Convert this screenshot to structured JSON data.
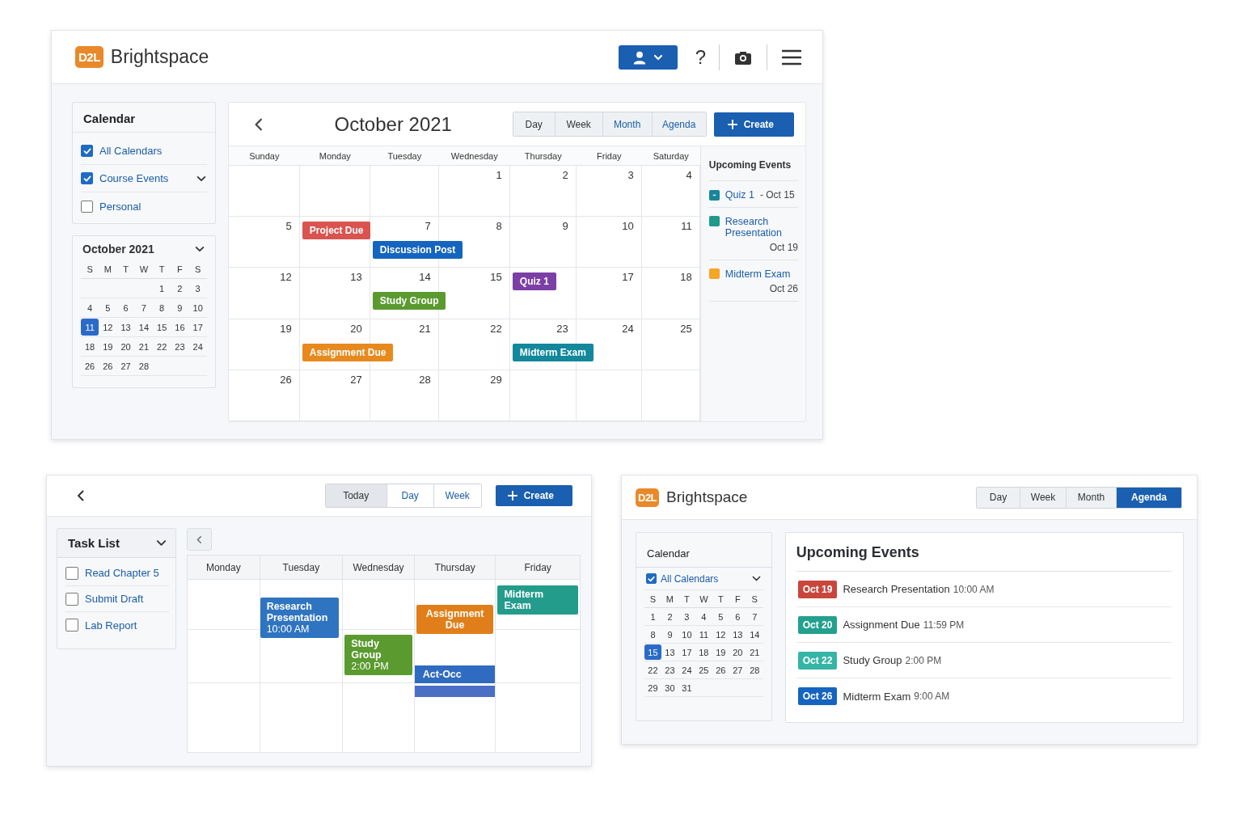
{
  "month_view": {
    "header": {
      "logo": "D2L",
      "brand": "Brightspace",
      "help": "?"
    },
    "filters": {
      "title": "Calendar",
      "items": [
        {
          "label": "All Calendars",
          "checked": true,
          "expandable": false
        },
        {
          "label": "Course Events",
          "checked": true,
          "expandable": true
        },
        {
          "label": "Personal",
          "checked": false,
          "expandable": false
        }
      ]
    },
    "mini_calendar": {
      "title": "October 2021",
      "weekdays": [
        "S",
        "M",
        "T",
        "W",
        "T",
        "F",
        "S"
      ],
      "weeks": [
        {
          "kind": "leading",
          "days": [
            {
              "day": "1",
              "selected": false
            },
            {
              "day": "2",
              "selected": false
            },
            {
              "day": "3",
              "selected": false
            }
          ]
        },
        {
          "days": [
            {
              "day": "4",
              "selected": false
            },
            {
              "day": "5",
              "selected": false
            },
            {
              "day": "6",
              "selected": false
            },
            {
              "day": "7",
              "selected": false
            },
            {
              "day": "8",
              "selected": false
            },
            {
              "day": "9",
              "selected": false
            },
            {
              "day": "10",
              "selected": false
            }
          ]
        },
        {
          "days": [
            {
              "day": "11",
              "selected": true
            },
            {
              "day": "12",
              "selected": false
            },
            {
              "day": "13",
              "selected": false
            },
            {
              "day": "14",
              "selected": false
            },
            {
              "day": "15",
              "selected": false
            },
            {
              "day": "16",
              "selected": false
            },
            {
              "day": "17",
              "selected": false
            }
          ]
        },
        {
          "days": [
            {
              "day": "18",
              "selected": false
            },
            {
              "day": "19",
              "selected": false
            },
            {
              "day": "20",
              "selected": false
            },
            {
              "day": "21",
              "selected": false
            },
            {
              "day": "22",
              "selected": false
            },
            {
              "day": "23",
              "selected": false
            },
            {
              "day": "24",
              "selected": false
            }
          ]
        },
        {
          "days": [
            {
              "day": "26",
              "selected": false
            },
            {
              "day": "26",
              "selected": false
            },
            {
              "day": "27",
              "selected": false
            },
            {
              "day": "28",
              "selected": false
            }
          ]
        }
      ]
    },
    "toolbar": {
      "title": "October 2021",
      "tabs": [
        {
          "label": "Day",
          "selected": false
        },
        {
          "label": "Week",
          "selected": false
        },
        {
          "label": "Month",
          "selected": false
        },
        {
          "label": "Agenda",
          "selected": false
        }
      ],
      "create": "Create"
    },
    "weekdays": [
      "Sunday",
      "Monday",
      "Tuesday",
      "Wednesday",
      "Thursday",
      "Friday",
      "Saturday"
    ],
    "weeks": [
      {
        "kind": "leading",
        "cells": [
          {
            "day": "1"
          },
          {
            "day": "2"
          },
          {
            "day": "3"
          },
          {
            "day": "4"
          }
        ]
      },
      {
        "cells": [
          {
            "day": "5"
          },
          {
            "events": [
              {
                "title": "Project Due",
                "color": "#d9534f"
              }
            ]
          },
          {
            "day": "7",
            "events": [
              {
                "title": "Discussion Post",
                "color": "#1565c0"
              }
            ]
          },
          {
            "day": "8"
          },
          {
            "day": "9"
          },
          {
            "day": "10"
          },
          {
            "day": "11"
          }
        ]
      },
      {
        "cells": [
          {
            "day": "12"
          },
          {
            "day": "13"
          },
          {
            "day": "14",
            "events": [
              {
                "title": "Study Group",
                "color": "#5a9a2f"
              }
            ]
          },
          {
            "day": "15"
          },
          {
            "events": [
              {
                "title": "Quiz 1",
                "color": "#7b3fa6"
              }
            ]
          },
          {
            "day": "17"
          },
          {
            "day": "18"
          }
        ]
      },
      {
        "cells": [
          {
            "day": "19"
          },
          {
            "day": "20",
            "events": [
              {
                "title": "Assignment Due",
                "color": "#e8891e"
              }
            ]
          },
          {
            "day": "21"
          },
          {
            "day": "22"
          },
          {
            "day": "23",
            "events": [
              {
                "title": "Midterm Exam",
                "color": "#13879b"
              }
            ]
          },
          {
            "day": "24"
          },
          {
            "day": "25"
          }
        ]
      },
      {
        "cells": [
          {
            "day": "26"
          },
          {
            "day": "27"
          },
          {
            "day": "28"
          },
          {
            "day": "29"
          }
        ]
      }
    ],
    "upcoming": {
      "title": "Upcoming Events",
      "items": [
        {
          "kind": "task",
          "title": "Quiz 1",
          "date": "- Oct 15",
          "color": "#17869b"
        },
        {
          "kind": "event",
          "title": "Research Presentation",
          "date": "Oct 19",
          "color": "#1f9a8a"
        },
        {
          "kind": "event",
          "title": "Midterm Exam",
          "date": "Oct 26",
          "color": "#f5a623"
        }
      ]
    }
  },
  "week_view": {
    "tabs": [
      {
        "label": "Today",
        "selected": true
      },
      {
        "label": "Day",
        "selected": false
      },
      {
        "label": "Week",
        "selected": false
      }
    ],
    "create": "Create",
    "tasks": {
      "title": "Task List",
      "items": [
        {
          "label": "Read Chapter 5",
          "checked": false
        },
        {
          "label": "Submit Draft",
          "checked": false
        },
        {
          "label": "Lab Report",
          "checked": false
        }
      ]
    },
    "columns": [
      {
        "name": "Monday"
      },
      {
        "name": "Tuesday",
        "events": [
          {
            "kind": "block",
            "title": "Research Presentation",
            "time": "10:00 AM",
            "color": "#2f74c0"
          }
        ]
      },
      {
        "name": "Wednesday",
        "events": [
          {
            "kind": "block",
            "title": "Study Group",
            "time": "2:00 PM",
            "color": "#5a9a2f"
          }
        ]
      },
      {
        "name": "Thursday",
        "events": [
          {
            "kind": "block",
            "title": "Assignment Due",
            "color": "#e07f1a"
          },
          {
            "kind": "block",
            "title": "Act-Occ",
            "color": "#2f6bc0"
          },
          {
            "kind": "bar",
            "color": "#4a6fc4"
          }
        ]
      },
      {
        "name": "Friday",
        "events": [
          {
            "kind": "block",
            "title": "Midterm Exam",
            "color": "#249c8c"
          }
        ]
      }
    ]
  },
  "agenda_view": {
    "header": {
      "logo": "D2L",
      "brand": "Brightspace"
    },
    "tabs": [
      {
        "label": "Day",
        "selected": false
      },
      {
        "label": "Week",
        "selected": false
      },
      {
        "label": "Month",
        "selected": false
      },
      {
        "label": "Agenda",
        "selected": true
      }
    ],
    "calendar": {
      "title": "Calendar",
      "filter": {
        "label": "All Calendars",
        "checked": true
      },
      "weekdays": [
        "S",
        "M",
        "T",
        "W",
        "T",
        "F",
        "S"
      ],
      "weeks": [
        {
          "days": [
            {
              "day": "1",
              "selected": false
            },
            {
              "day": "2",
              "selected": false
            },
            {
              "day": "3",
              "selected": false
            },
            {
              "day": "4",
              "selected": false
            },
            {
              "day": "5",
              "selected": false
            },
            {
              "day": "6",
              "selected": false
            },
            {
              "day": "7",
              "selected": false
            }
          ]
        },
        {
          "days": [
            {
              "day": "8",
              "selected": false
            },
            {
              "day": "9",
              "selected": false
            },
            {
              "day": "10",
              "selected": false
            },
            {
              "day": "11",
              "selected": false
            },
            {
              "day": "12",
              "selected": false
            },
            {
              "day": "13",
              "selected": false
            },
            {
              "day": "14",
              "selected": false
            }
          ]
        },
        {
          "days": [
            {
              "day": "15",
              "selected": true
            },
            {
              "day": "13",
              "selected": false
            },
            {
              "day": "17",
              "selected": false
            },
            {
              "day": "18",
              "selected": false
            },
            {
              "day": "19",
              "selected": false
            },
            {
              "day": "20",
              "selected": false
            },
            {
              "day": "21",
              "selected": false
            }
          ]
        },
        {
          "days": [
            {
              "day": "22",
              "selected": false
            },
            {
              "day": "23",
              "selected": false
            },
            {
              "day": "24",
              "selected": false
            },
            {
              "day": "25",
              "selected": false
            },
            {
              "day": "26",
              "selected": false
            },
            {
              "day": "27",
              "selected": false
            },
            {
              "day": "28",
              "selected": false
            }
          ]
        },
        {
          "days": [
            {
              "day": "29",
              "selected": false
            },
            {
              "day": "30",
              "selected": false
            },
            {
              "day": "31",
              "selected": false
            }
          ]
        }
      ]
    },
    "upcoming": {
      "title": "Upcoming Events",
      "items": [
        {
          "date": "Oct 19",
          "color": "#c9463d",
          "title": "Research Presentation",
          "time": "10:00 AM"
        },
        {
          "date": "Oct 20",
          "color": "#24a08f",
          "title": "Assignment Due",
          "time": "11:59 PM"
        },
        {
          "date": "Oct 22",
          "color": "#35b5a5",
          "title": "Study Group",
          "time": "2:00 PM"
        },
        {
          "date": "Oct 26",
          "color": "#1565c0",
          "title": "Midterm Exam",
          "time": "9:00 AM"
        }
      ]
    }
  }
}
